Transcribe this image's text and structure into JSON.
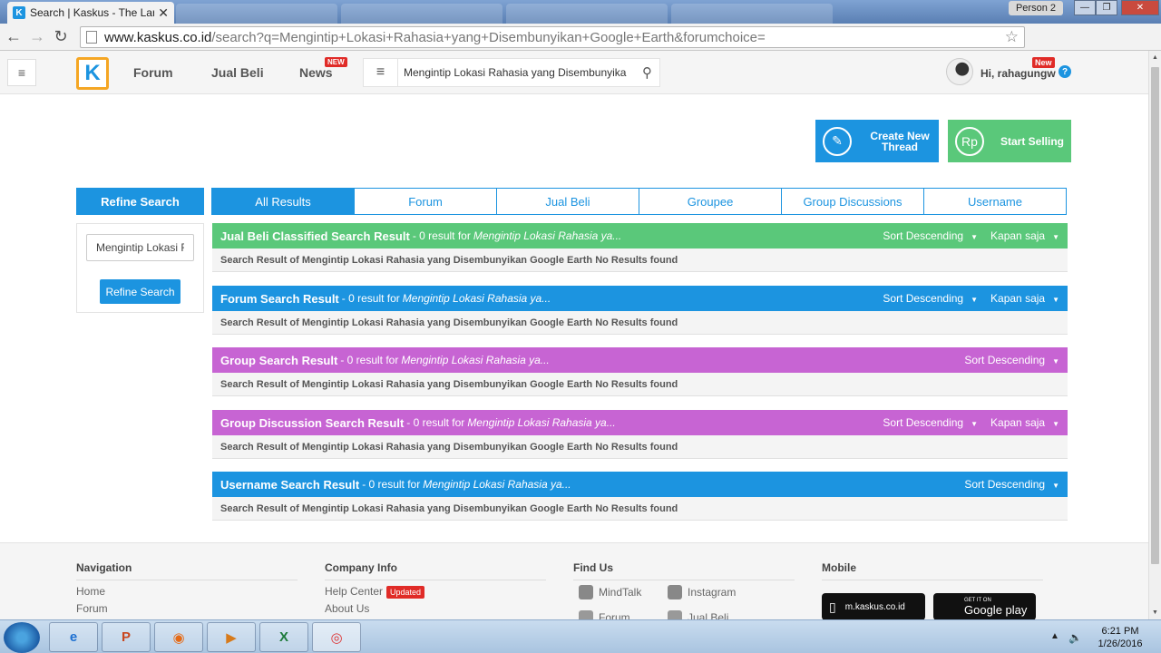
{
  "browser": {
    "tab_title": "Search | Kaskus - The Larg",
    "tab_close": "✕",
    "profile": "Person 2",
    "url_host": "www.kaskus.co.id",
    "url_path": "/search?q=Mengintip+Lokasi+Rahasia+yang+Disembunyikan+Google+Earth&forumchoice=",
    "back": "←",
    "forward": "→",
    "reload": "↻",
    "star": "☆",
    "win_min": "—",
    "win_max": "❐",
    "win_close": "✕"
  },
  "header": {
    "logo": "K",
    "menu_icon": "≡",
    "nav": [
      {
        "label": "Forum"
      },
      {
        "label": "Jual Beli"
      },
      {
        "label": "News",
        "badge": "NEW"
      }
    ],
    "search_value": "Mengintip Lokasi Rahasia yang Disembunyika",
    "search_icon": "⚲",
    "greeting": "Hi, rahagungw",
    "greeting_badge": "New",
    "help": "?"
  },
  "actions": {
    "create_icon": "✎",
    "create_label_1": "Create New",
    "create_label_2": "Thread",
    "sell_icon": "Rp",
    "sell_label": "Start Selling"
  },
  "refine": {
    "title": "Refine Search",
    "input_value": "Mengintip Lokasi Rahasia yang Disembunyikan Google Earth",
    "button": "Refine Search"
  },
  "tabs": [
    {
      "label": "All Results",
      "active": true
    },
    {
      "label": "Forum"
    },
    {
      "label": "Jual Beli"
    },
    {
      "label": "Groupee"
    },
    {
      "label": "Group Discussions"
    },
    {
      "label": "Username"
    }
  ],
  "results": [
    {
      "title": "Jual Beli Classified Search Result",
      "count": "- 0 result for",
      "query": "Mengintip Lokasi Rahasia ya...",
      "sort": "Sort Descending",
      "time": "Kapan saja",
      "body": "Search Result of Mengintip Lokasi Rahasia yang Disembunyikan Google Earth No Results found",
      "color": "#5ac87a"
    },
    {
      "title": "Forum Search Result",
      "count": "- 0 result for",
      "query": "Mengintip Lokasi Rahasia ya...",
      "sort": "Sort Descending",
      "time": "Kapan saja",
      "body": "Search Result of Mengintip Lokasi Rahasia yang Disembunyikan Google Earth No Results found",
      "color": "#1c94e0"
    },
    {
      "title": "Group Search Result",
      "count": "- 0 result for",
      "query": "Mengintip Lokasi Rahasia ya...",
      "sort": "Sort Descending",
      "time": "",
      "body": "Search Result of Mengintip Lokasi Rahasia yang Disembunyikan Google Earth No Results found",
      "color": "#c764d3"
    },
    {
      "title": "Group Discussion Search Result",
      "count": "- 0 result for",
      "query": "Mengintip Lokasi Rahasia ya...",
      "sort": "Sort Descending",
      "time": "Kapan saja",
      "body": "Search Result of Mengintip Lokasi Rahasia yang Disembunyikan Google Earth No Results found",
      "color": "#c764d3"
    },
    {
      "title": "Username Search Result",
      "count": "- 0 result for",
      "query": "Mengintip Lokasi Rahasia ya...",
      "sort": "Sort Descending",
      "time": "",
      "body": "Search Result of Mengintip Lokasi Rahasia yang Disembunyikan Google Earth No Results found",
      "color": "#1c94e0"
    }
  ],
  "footer": {
    "navigation": {
      "title": "Navigation",
      "links": [
        "Home",
        "Forum"
      ]
    },
    "company": {
      "title": "Company Info",
      "links": [
        "Help Center",
        "About Us"
      ],
      "updated_badge": "Updated"
    },
    "findus": {
      "title": "Find Us",
      "links": [
        "MindTalk",
        "Instagram",
        "Forum",
        "Jual Beli"
      ]
    },
    "mobile": {
      "title": "Mobile",
      "site": "m.kaskus.co.id",
      "play_small": "GET IT ON",
      "play": "Google play"
    }
  },
  "taskbar": {
    "time": "6:21 PM",
    "date": "1/26/2016"
  }
}
